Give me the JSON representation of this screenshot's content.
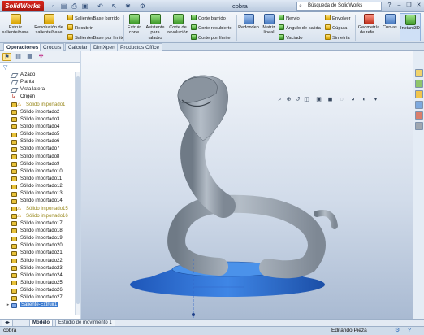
{
  "app": {
    "logo": "SolidWorks",
    "document_title": "cobra"
  },
  "search": {
    "placeholder": "Búsqueda de SolidWorks"
  },
  "ribbon": {
    "extrude_boss": "Extruir saliente/base",
    "revolve_boss": "Revolución de saliente/base",
    "sweep_boss": "Saliente/Base barrido",
    "cover": "Recubrir",
    "boundary_boss": "Saliente/Base por límite",
    "extrude_cut": "Extruir corte",
    "hole_wizard": "Asistente para taladro",
    "revolve_cut": "Corte de revolución",
    "sweep_cut": "Corte barrido",
    "loft_cut": "Corte recubierto",
    "boundary_cut": "Corte por límite",
    "fillet": "Redondeo",
    "linear_pattern": "Matriz lineal",
    "rib": "Nervio",
    "draft": "Ángulo de salida",
    "shell": "Vaciado",
    "wrap": "Envolver",
    "dome": "Cúpula",
    "mirror": "Simetría",
    "reference_geometry": "Geometría de refe...",
    "curves": "Curvas",
    "instant3d": "Instant3D"
  },
  "tabs": [
    "Operaciones",
    "Croquis",
    "Calcular",
    "DimXpert",
    "Productos Office"
  ],
  "tree": [
    {
      "label": "Alzado",
      "icon": "plane"
    },
    {
      "label": "Planta",
      "icon": "plane"
    },
    {
      "label": "Vista lateral",
      "icon": "plane"
    },
    {
      "label": "Origen",
      "icon": "origin"
    },
    {
      "label": "Sólido importado1",
      "icon": "solid",
      "warn": true
    },
    {
      "label": "Sólido importado2",
      "icon": "solid"
    },
    {
      "label": "Sólido importado3",
      "icon": "solid"
    },
    {
      "label": "Sólido importado4",
      "icon": "solid"
    },
    {
      "label": "Sólido importado5",
      "icon": "solid"
    },
    {
      "label": "Sólido importado6",
      "icon": "solid"
    },
    {
      "label": "Sólido importado7",
      "icon": "solid"
    },
    {
      "label": "Sólido importado8",
      "icon": "solid"
    },
    {
      "label": "Sólido importado9",
      "icon": "solid"
    },
    {
      "label": "Sólido importado10",
      "icon": "solid"
    },
    {
      "label": "Sólido importado11",
      "icon": "solid"
    },
    {
      "label": "Sólido importado12",
      "icon": "solid"
    },
    {
      "label": "Sólido importado13",
      "icon": "solid"
    },
    {
      "label": "Sólido importado14",
      "icon": "solid"
    },
    {
      "label": "Sólido importado15",
      "icon": "solid",
      "warn": true
    },
    {
      "label": "Sólido importado16",
      "icon": "solid",
      "warn": true
    },
    {
      "label": "Sólido importado17",
      "icon": "solid"
    },
    {
      "label": "Sólido importado18",
      "icon": "solid"
    },
    {
      "label": "Sólido importado19",
      "icon": "solid"
    },
    {
      "label": "Sólido importado20",
      "icon": "solid"
    },
    {
      "label": "Sólido importado21",
      "icon": "solid"
    },
    {
      "label": "Sólido importado22",
      "icon": "solid"
    },
    {
      "label": "Sólido importado23",
      "icon": "solid"
    },
    {
      "label": "Sólido importado24",
      "icon": "solid"
    },
    {
      "label": "Sólido importado25",
      "icon": "solid"
    },
    {
      "label": "Sólido importado26",
      "icon": "solid"
    },
    {
      "label": "Sólido importado27",
      "icon": "solid"
    },
    {
      "label": "Saliente-Extruir1",
      "icon": "solid",
      "selected": true
    }
  ],
  "bottom_tabs": [
    "Modelo",
    "Estudio de movimiento 1"
  ],
  "status": {
    "left": "cobra",
    "mode": "Editando Pieza"
  },
  "colors": {
    "base_blue": "#2f6fd0",
    "model_gray": "#8f9aa6",
    "accent": "#2f6ab7"
  }
}
